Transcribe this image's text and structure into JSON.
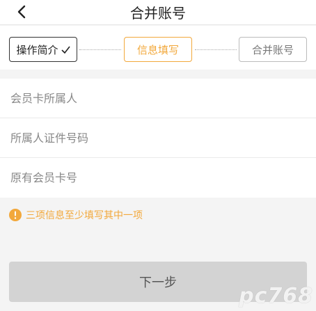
{
  "header": {
    "title": "合并账号"
  },
  "steps": [
    {
      "label": "操作简介",
      "state": "done"
    },
    {
      "label": "信息填写",
      "state": "active"
    },
    {
      "label": "合并账号",
      "state": "pending"
    }
  ],
  "form": {
    "fields": [
      {
        "placeholder": "会员卡所属人",
        "value": ""
      },
      {
        "placeholder": "所属人证件号码",
        "value": ""
      },
      {
        "placeholder": "原有会员卡号",
        "value": ""
      }
    ]
  },
  "notice": {
    "text": "三项信息至少填写其中一项"
  },
  "button": {
    "label": "下一步"
  },
  "watermark": {
    "text": "pc768"
  },
  "colors": {
    "accent": "#f2a83b",
    "button_bg": "#d3d3d3",
    "page_bg": "#f4f4f4"
  },
  "icons": {
    "back": "chevron-left-icon",
    "check": "check-icon",
    "warning": "warning-circle-icon"
  }
}
